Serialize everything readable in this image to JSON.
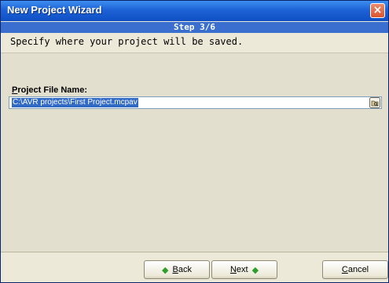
{
  "window": {
    "title": "New Project Wizard",
    "close_glyph": "×"
  },
  "step": {
    "label": "Step 3/6"
  },
  "instruction": "Specify where your project will be saved.",
  "project_file": {
    "label_prefix": "P",
    "label_rest": "roject File Name:",
    "value": "C:\\AVR projects\\First Project.mcpav",
    "browse_icon": "folder-browse-icon"
  },
  "buttons": {
    "back": {
      "arrow": "◆",
      "mnemonic": "B",
      "rest": "ack"
    },
    "next": {
      "mnemonic": "N",
      "rest": "ext",
      "arrow": "◆"
    },
    "cancel": {
      "mnemonic": "C",
      "rest": "ancel"
    }
  },
  "colors": {
    "titlebar": "#1d62d6",
    "stepbar": "#3a6fd0",
    "selection": "#316ac5",
    "panel": "#e3dfce"
  }
}
